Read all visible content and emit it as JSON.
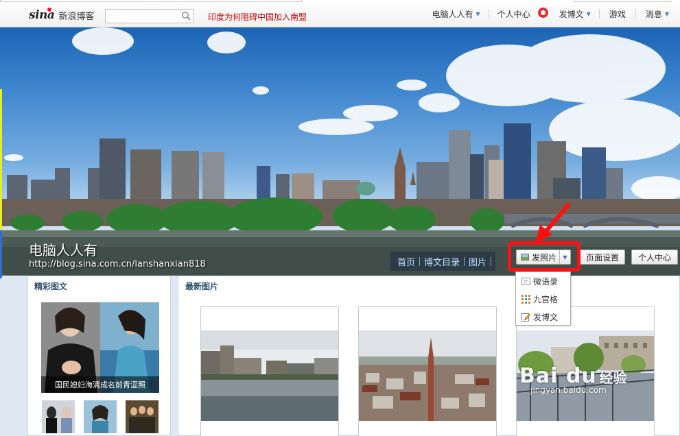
{
  "topbar": {
    "logo_brand": "sina",
    "logo_text": "新浪博客",
    "search_placeholder": "",
    "headline_link": "印度为何阻碍中国加入南盟",
    "nav": [
      {
        "label": "电脑人人有",
        "has_dropdown": true
      },
      {
        "label": "个人中心",
        "has_dropdown": false,
        "badge": true
      },
      {
        "label": "发博文",
        "has_dropdown": true
      },
      {
        "label": "游戏",
        "has_dropdown": false
      },
      {
        "label": "消息",
        "has_dropdown": true
      }
    ]
  },
  "banner": {
    "blog_title": "电脑人人有",
    "blog_url": "http://blog.sina.com.cn/lanshanxian818",
    "nav_links": [
      "首页",
      "博文目录",
      "图片"
    ],
    "photo_button": "发照片",
    "page_settings_button": "页面设置",
    "personal_center_button": "个人中心"
  },
  "post_menu": {
    "items": [
      {
        "label": "微语录",
        "icon": "quote-icon"
      },
      {
        "label": "九宫格",
        "icon": "grid-icon"
      },
      {
        "label": "发博文",
        "icon": "edit-icon"
      }
    ]
  },
  "left_panel": {
    "title": "精彩图文",
    "feature_caption": "国民媳妇海清成名前青涩照"
  },
  "right_panel": {
    "title": "最新图片"
  },
  "watermark": {
    "brand": "Bai du",
    "subtitle": "经验",
    "url": "jingyan.baidu.com"
  },
  "colors": {
    "headline_red": "#c00000",
    "highlight_red": "#ff1010",
    "panel_title": "#2e4f6e",
    "link_blue": "#bfe0ff"
  }
}
